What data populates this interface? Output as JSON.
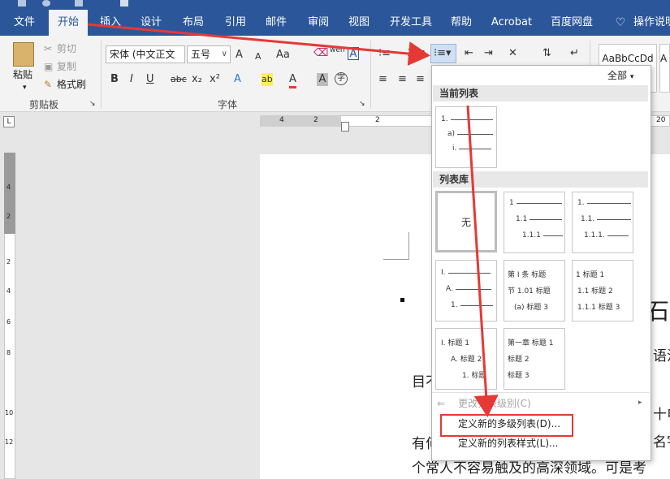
{
  "ribbon_tabs": [
    "文件",
    "开始",
    "插入",
    "设计",
    "布局",
    "引用",
    "邮件",
    "审阅",
    "视图",
    "开发工具",
    "帮助",
    "Acrobat",
    "百度网盘",
    "操作说明"
  ],
  "clipboard": {
    "paste": "粘贴",
    "cut": "剪切",
    "copy": "复制",
    "format_painter": "格式刷",
    "label": "剪贴板"
  },
  "font": {
    "name": "宋体 (中文正文",
    "size": "五号",
    "label": "字体",
    "grow_glyph": "A",
    "shrink_glyph": "A",
    "case_glyph": "Aa",
    "phonetic_glyph": "wén",
    "border_glyph": "A",
    "bold": "B",
    "italic": "I",
    "underline": "U",
    "strikethrough": "abc",
    "subscript": "x₂",
    "superscript": "x²",
    "effects_glyph": "A",
    "highlight_glyph": "ab",
    "color_glyph": "A",
    "shading_glyph": "A",
    "enclose_glyph": "字"
  },
  "styles": {
    "preview": "AaBbCcDd",
    "preview2": "A"
  },
  "ruler_labels": [
    "4",
    "2",
    "2",
    "20"
  ],
  "vruler_labels": [
    "4",
    "2",
    "2",
    "4",
    "6",
    "8",
    "10",
    "12"
  ],
  "doc_lines": [
    "石贝",
    "语浩",
    "目不",
    "十电",
    "有何",
    "名宇",
    "个常人不容易触及的高深领域。可是考"
  ],
  "list_panel": {
    "filter": "全部",
    "current_section": "当前列表",
    "library_section": "列表库",
    "current_tile": [
      "1.",
      "a)",
      "i."
    ],
    "none_label": "无",
    "tiles": [
      {
        "rows": [
          "1",
          "1.1",
          "1.1.1"
        ]
      },
      {
        "rows": [
          "1.",
          "1.1.",
          "1.1.1."
        ]
      },
      {
        "rows": [
          "I.",
          "A.",
          "1."
        ]
      },
      {
        "rows": [
          "第 Ⅰ 条 标题",
          "节 1.01 标题",
          "(a) 标题 3"
        ]
      },
      {
        "rows": [
          "1 标题 1",
          "1.1 标题 2",
          "1.1.1 标题 3"
        ]
      },
      {
        "rows": [
          "I. 标题 1",
          "A. 标题 2",
          "1. 标题"
        ]
      },
      {
        "rows": [
          "第一章 标题 1",
          "标题 2",
          "标题 3"
        ]
      }
    ],
    "change_level": "更改列表级别(C)",
    "define_new_multilevel": "定义新的多级列表(D)...",
    "define_new_style": "定义新的列表样式(L)..."
  },
  "colors": {
    "accent": "#2b579a",
    "annotation_red": "#e53935"
  }
}
